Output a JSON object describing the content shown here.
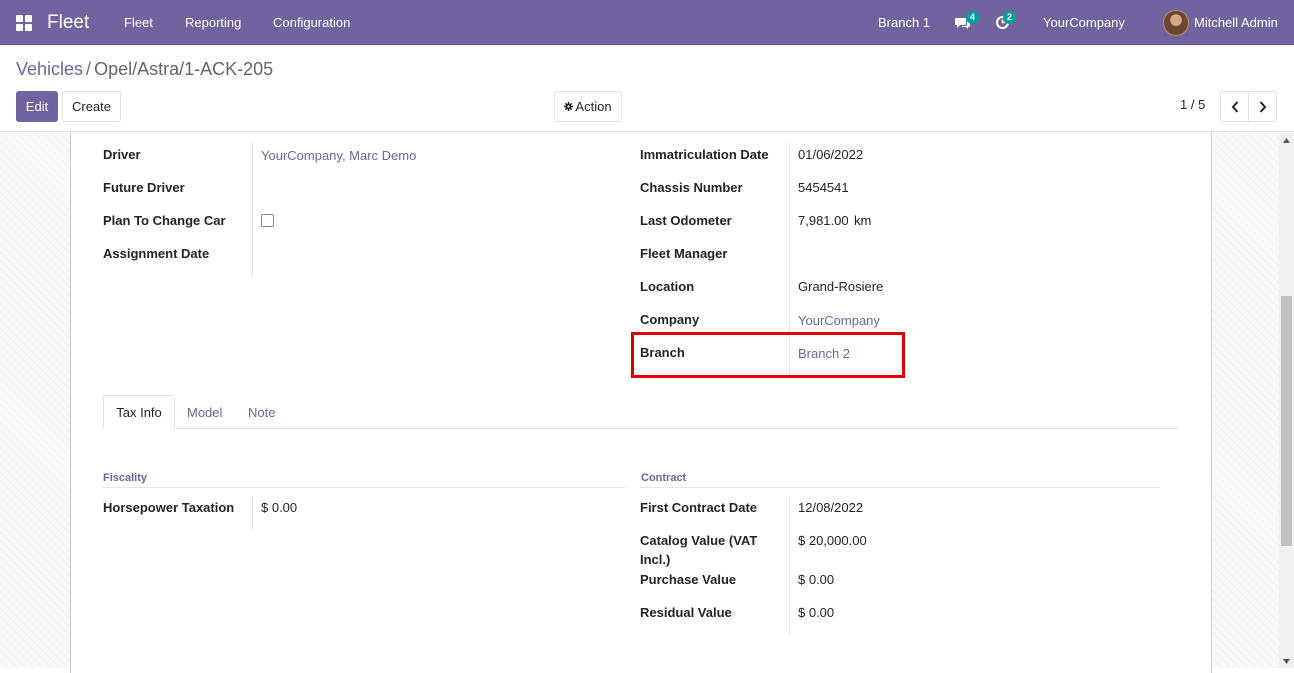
{
  "navbar": {
    "app_name": "Fleet",
    "menus": [
      "Fleet",
      "Reporting",
      "Configuration"
    ],
    "branch": "Branch 1",
    "messages_count": "4",
    "activities_count": "2",
    "company": "YourCompany",
    "user": "Mitchell Admin"
  },
  "breadcrumb": {
    "parent": "Vehicles",
    "separator": "/",
    "current": "Opel/Astra/1-ACK-205"
  },
  "buttons": {
    "edit": "Edit",
    "create": "Create",
    "action": "Action"
  },
  "pager": {
    "text": "1 / 5"
  },
  "left_fields": {
    "driver_label": "Driver",
    "driver_value": "YourCompany, Marc Demo",
    "future_driver_label": "Future Driver",
    "plan_change_label": "Plan To Change Car",
    "assignment_date_label": "Assignment Date"
  },
  "right_fields": {
    "immatriculation_label": "Immatriculation Date",
    "immatriculation_value": "01/06/2022",
    "chassis_label": "Chassis Number",
    "chassis_value": "5454541",
    "odometer_label": "Last Odometer",
    "odometer_value": "7,981.00",
    "odometer_unit": "km",
    "fleet_manager_label": "Fleet Manager",
    "location_label": "Location",
    "location_value": "Grand-Rosiere",
    "company_label": "Company",
    "company_value": "YourCompany",
    "branch_label": "Branch",
    "branch_value": "Branch 2"
  },
  "tabs": [
    "Tax Info",
    "Model",
    "Note"
  ],
  "fiscality": {
    "title": "Fiscality",
    "horsepower_label": "Horsepower Taxation",
    "horsepower_value": "$ 0.00"
  },
  "contract": {
    "title": "Contract",
    "first_contract_label": "First Contract Date",
    "first_contract_value": "12/08/2022",
    "catalog_label_1": "Catalog Value (VAT",
    "catalog_label_2": "Incl.)",
    "catalog_value": "$ 20,000.00",
    "purchase_label": "Purchase Value",
    "purchase_value": "$ 0.00",
    "residual_label": "Residual Value",
    "residual_value": "$ 0.00"
  },
  "colors": {
    "brand": "#71639e",
    "badge": "#00a09d",
    "highlight": "#e00000"
  }
}
